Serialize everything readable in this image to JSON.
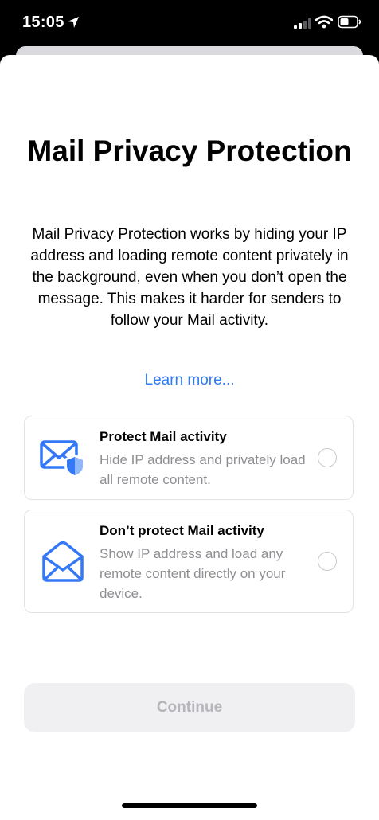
{
  "status_bar": {
    "time": "15:05",
    "icons": [
      "location-arrow-icon",
      "cellular-signal-icon",
      "wifi-icon",
      "battery-icon"
    ]
  },
  "sheet": {
    "title": "Mail Privacy Protection",
    "description": "Mail Privacy Protection works by hiding your IP address and loading remote content privately in the background, even when you don’t open the message. This makes it harder for senders to follow your Mail activity.",
    "learn_more": "Learn more...",
    "options": [
      {
        "title": "Protect Mail activity",
        "subtitle": "Hide IP address and privately load all remote content.",
        "icon": "envelope-shield-icon",
        "selected": false
      },
      {
        "title": "Don’t protect Mail activity",
        "subtitle": "Show IP address and load any remote content directly on your device.",
        "icon": "open-envelope-icon",
        "selected": false
      }
    ],
    "continue_label": "Continue",
    "continue_enabled": false
  },
  "colors": {
    "accent": "#2f7cf6",
    "icon_blue": "#3478f6",
    "secondary_text": "#8e8e93",
    "disabled_button_bg": "#f0f0f2",
    "disabled_button_text": "#b5b5ba"
  }
}
